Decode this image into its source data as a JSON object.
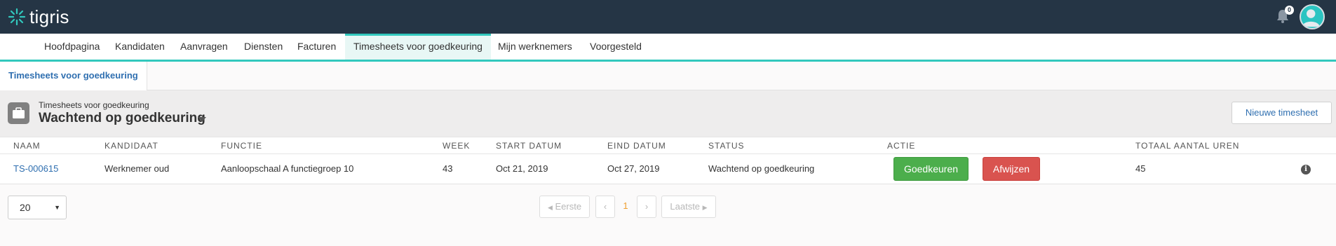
{
  "app": {
    "logo_text": "tigris",
    "notification_count": "0"
  },
  "nav": {
    "items": [
      {
        "label": "Hoofdpagina"
      },
      {
        "label": "Kandidaten"
      },
      {
        "label": "Aanvragen"
      },
      {
        "label": "Diensten"
      },
      {
        "label": "Facturen"
      },
      {
        "label": "Timesheets voor goedkeuring"
      },
      {
        "label": "Mijn werknemers"
      },
      {
        "label": "Voorgesteld"
      }
    ],
    "active_index": 5
  },
  "tabs": {
    "active_label": "Timesheets voor goedkeuring"
  },
  "header": {
    "subtitle": "Timesheets voor goedkeuring",
    "title": "Wachtend op goedkeuring",
    "new_button": "Nieuwe timesheet"
  },
  "table": {
    "columns": [
      "NAAM",
      "KANDIDAAT",
      "FUNCTIE",
      "WEEK",
      "START DATUM",
      "EIND DATUM",
      "STATUS",
      "ACTIE",
      "TOTAAL AANTAL UREN"
    ],
    "rows": [
      {
        "naam": "TS-000615",
        "kandidaat": "Werknemer oud",
        "functie": "Aanloopschaal A functiegroep 10",
        "week": "43",
        "start": "Oct 21, 2019",
        "eind": "Oct 27, 2019",
        "status": "Wachtend op goedkeuring",
        "approve_label": "Goedkeuren",
        "reject_label": "Afwijzen",
        "uren": "45"
      }
    ]
  },
  "pagination": {
    "page_size": "20",
    "first_label": "Eerste",
    "last_label": "Laatste",
    "current_page": "1"
  },
  "colors": {
    "topbar": "#253545",
    "accent": "#32c8bd",
    "link": "#2f6fb0",
    "approve": "#4cae4c",
    "reject": "#d9534f"
  }
}
